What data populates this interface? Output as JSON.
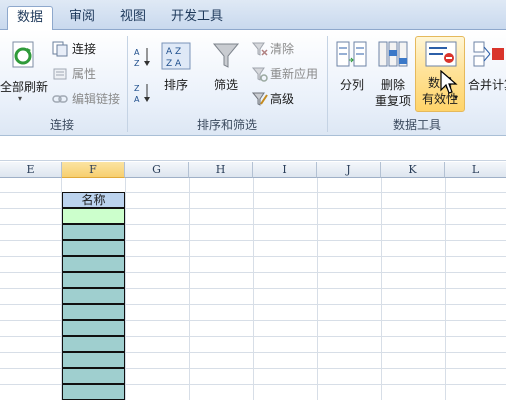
{
  "tabs": [
    "数据",
    "审阅",
    "视图",
    "开发工具"
  ],
  "ribbon": {
    "connections": {
      "refresh_all": "全部刷新",
      "connect": "连接",
      "properties": "属性",
      "edit_links": "编辑链接",
      "group_label": "连接"
    },
    "sort_filter": {
      "sort": "排序",
      "filter": "筛选",
      "clear": "清除",
      "reapply": "重新应用",
      "advanced": "高级",
      "group_label": "排序和筛选"
    },
    "data_tools": {
      "split_columns": "分列",
      "remove_dup_line1": "删除",
      "remove_dup_line2": "重复项",
      "validation_line1": "数据",
      "validation_line2": "有效性",
      "consolidate": "合并计算",
      "group_label": "数据工具"
    }
  },
  "columns": [
    "E",
    "F",
    "G",
    "H",
    "I",
    "J",
    "K",
    "L"
  ],
  "selected_column": "F",
  "table": {
    "header": "名称",
    "rows": 12
  },
  "colors": {
    "header_fill": "#bcd3ee",
    "data_fill": "#9fcfcf",
    "first_row_fill": "#ccffcc"
  }
}
